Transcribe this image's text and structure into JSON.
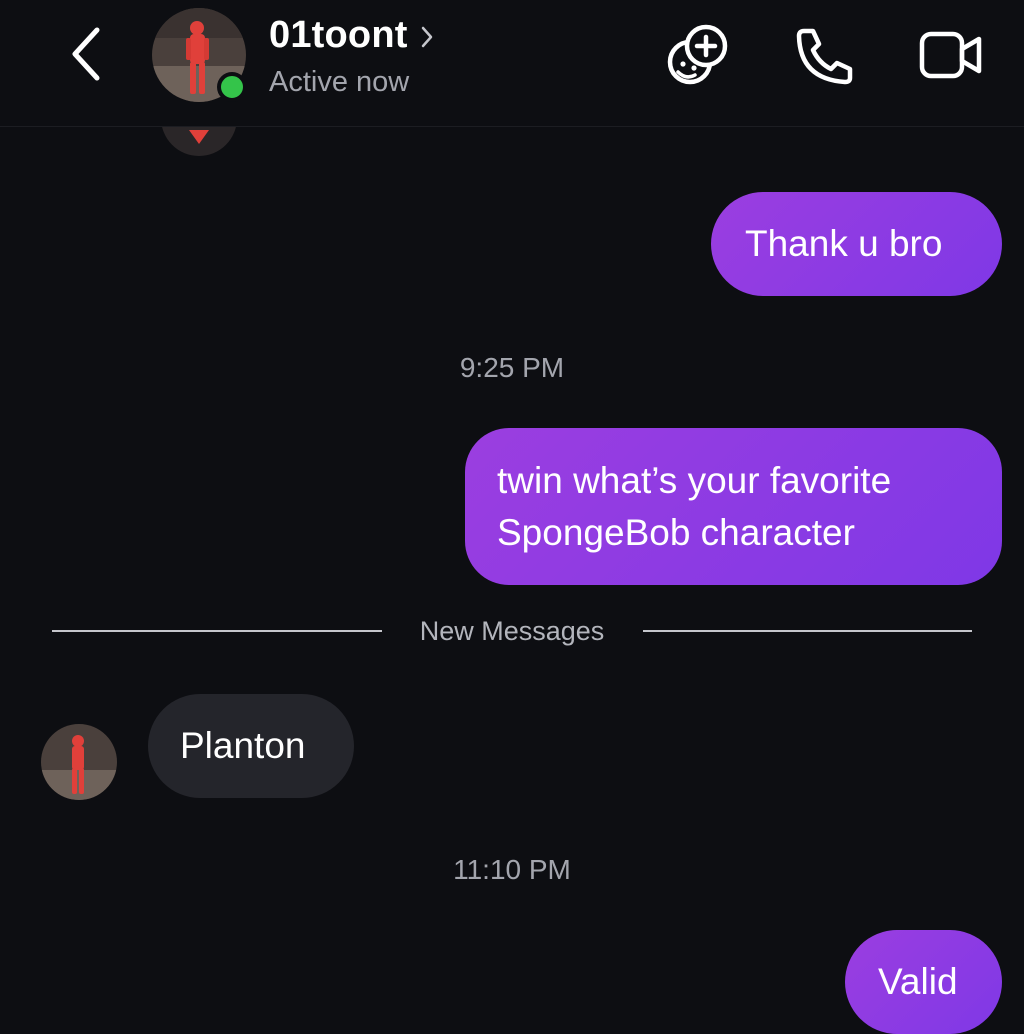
{
  "header": {
    "back_icon": "chevron-left-icon",
    "username": "01toont",
    "status": "Active now",
    "actions": [
      {
        "icon": "add-friends-icon"
      },
      {
        "icon": "phone-icon"
      },
      {
        "icon": "video-camera-icon"
      }
    ],
    "online_color": "#34c44a"
  },
  "messages": [
    {
      "direction": "outgoing",
      "text": "Thank u bro"
    },
    {
      "type": "timestamp",
      "text": "9:25 PM"
    },
    {
      "direction": "outgoing",
      "lines": [
        "twin what’s your favorite",
        "SpongeBob character"
      ]
    },
    {
      "type": "divider",
      "text": "New Messages"
    },
    {
      "direction": "incoming",
      "text": "Planton"
    },
    {
      "type": "timestamp",
      "text": "11:10 PM"
    },
    {
      "direction": "outgoing",
      "text": "Valid"
    }
  ],
  "colors": {
    "background": "#0d0e12",
    "outgoing_bubble": "#8a3bdd",
    "incoming_bubble": "#24252b",
    "meta_text": "#a3a5ad"
  }
}
